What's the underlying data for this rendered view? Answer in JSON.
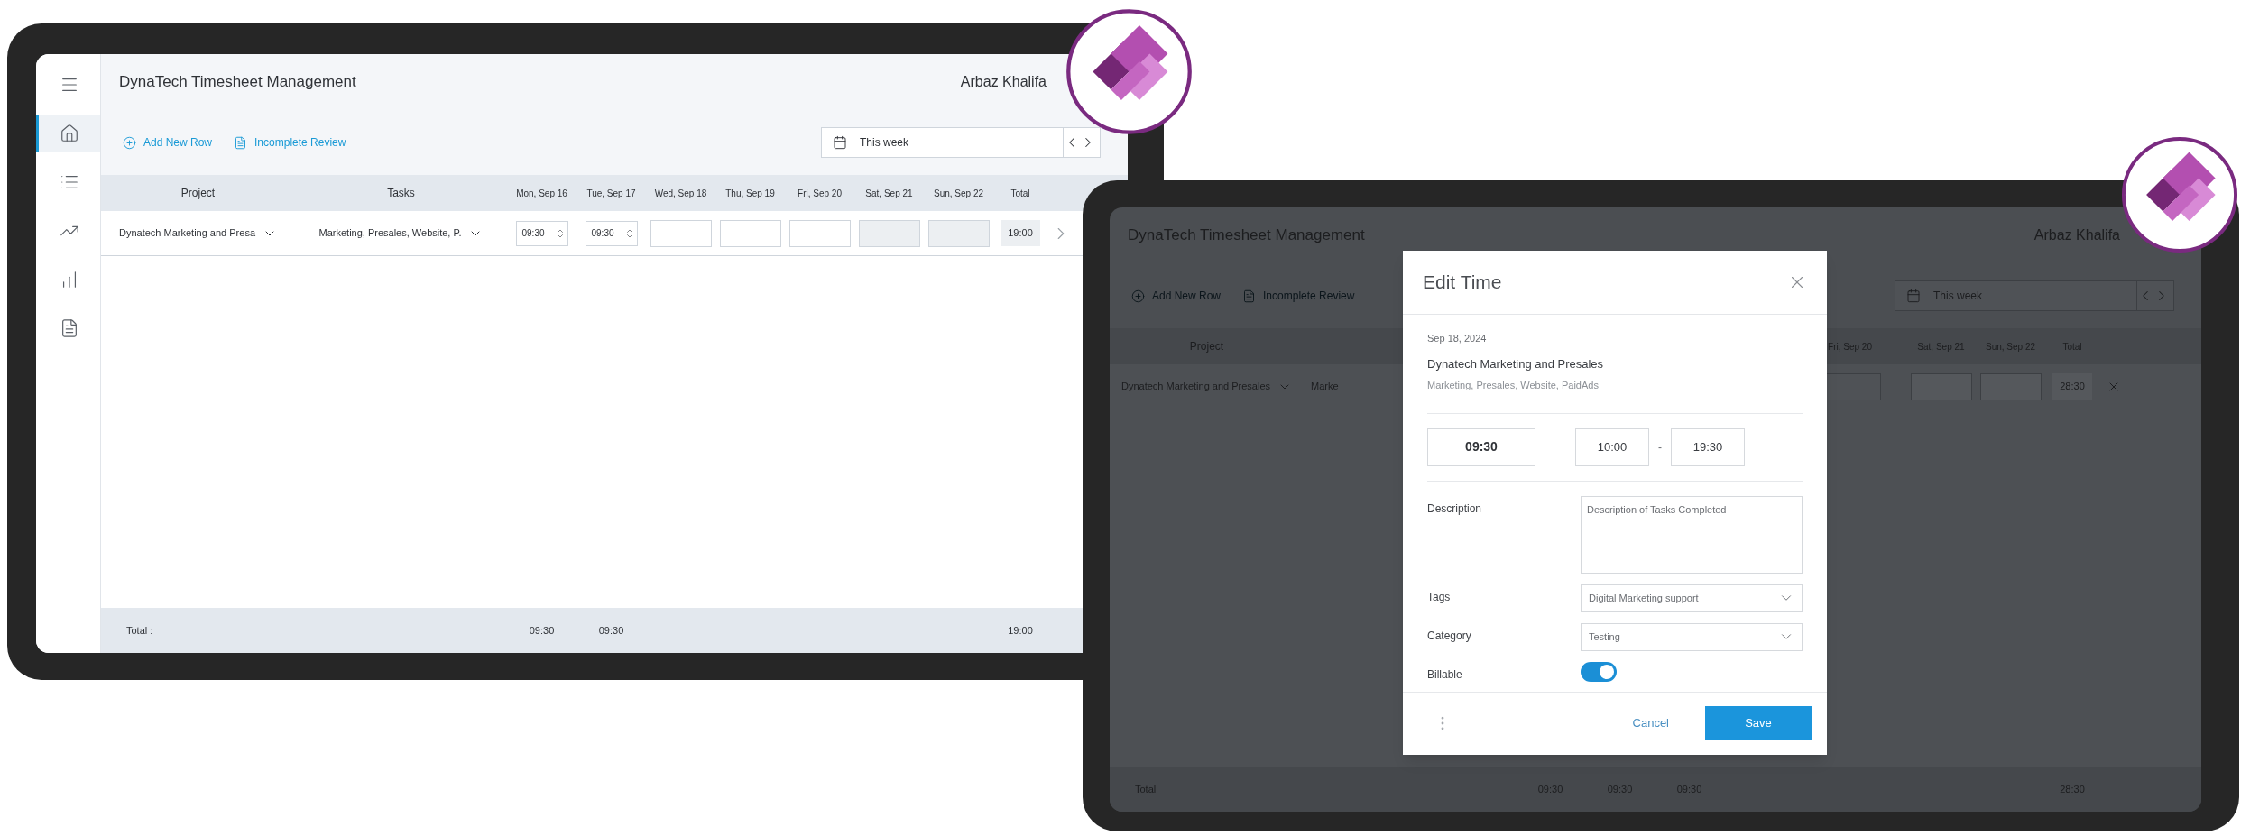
{
  "screens": [
    {
      "dimmed": false,
      "sidebar": [
        {
          "kind": "menu",
          "selected": false
        },
        {
          "kind": "home",
          "selected": true
        },
        {
          "kind": "list",
          "selected": false
        },
        {
          "kind": "trend",
          "selected": false
        },
        {
          "kind": "bars",
          "selected": false
        },
        {
          "kind": "pdf",
          "selected": false
        }
      ],
      "title": "DynaTech Timesheet Management",
      "user": "Arbaz Khalifa",
      "actions": [
        {
          "kind": "add",
          "label": "Add New Row"
        },
        {
          "kind": "review",
          "label": "Incomplete Review"
        }
      ],
      "week": "This week",
      "columns": [
        {
          "kind": "shown",
          "label": "Project"
        },
        {
          "kind": "shown",
          "label": "Tasks"
        },
        {
          "kind": "shown",
          "label": "Mon, Sep 16"
        },
        {
          "kind": "shown",
          "label": "Tue, Sep 17"
        },
        {
          "kind": "shown",
          "label": "Wed, Sep 18"
        },
        {
          "kind": "shown",
          "label": "Thu, Sep 19"
        },
        {
          "kind": "shown",
          "label": "Fri, Sep 20"
        },
        {
          "kind": "shown",
          "label": "Sat, Sep 21"
        },
        {
          "kind": "shown",
          "label": "Sun, Sep 22"
        },
        {
          "kind": "shown",
          "label": "Total"
        }
      ],
      "row": [
        {
          "kind": "select",
          "text": "Dynatech Marketing and Presa"
        },
        {
          "kind": "select",
          "text": "Marketing, Presales, Website, P."
        },
        {
          "kind": "time",
          "text": "09:30"
        },
        {
          "kind": "time",
          "text": "09:30"
        },
        {
          "kind": "empty"
        },
        {
          "kind": "empty"
        },
        {
          "kind": "empty"
        },
        {
          "kind": "disabled"
        },
        {
          "kind": "disabled"
        },
        {
          "kind": "total",
          "text": "19:00"
        },
        {
          "kind": "next"
        }
      ],
      "footer": [
        {
          "kind": "label",
          "text": "Total :"
        },
        {
          "kind": "blank"
        },
        {
          "kind": "value",
          "text": "09:30"
        },
        {
          "kind": "value",
          "text": "09:30"
        },
        {
          "kind": "blank"
        },
        {
          "kind": "blank"
        },
        {
          "kind": "blank"
        },
        {
          "kind": "blank"
        },
        {
          "kind": "blank"
        },
        {
          "kind": "value",
          "text": "19:00"
        }
      ]
    },
    {
      "dimmed": true,
      "title": "DynaTech Timesheet Management",
      "user": "Arbaz Khalifa",
      "actions": [
        {
          "kind": "add",
          "label": "Add New Row"
        },
        {
          "kind": "review",
          "label": "Incomplete Review"
        }
      ],
      "week": "This week",
      "columns": [
        {
          "kind": "shown",
          "label": "Project"
        },
        {
          "kind": "covered"
        },
        {
          "kind": "covered"
        },
        {
          "kind": "covered"
        },
        {
          "kind": "covered"
        },
        {
          "kind": "covered"
        },
        {
          "kind": "shown",
          "label": "Fri, Sep 20"
        },
        {
          "kind": "shown",
          "label": "Sat, Sep 21"
        },
        {
          "kind": "shown",
          "label": "Sun, Sep 22"
        },
        {
          "kind": "shown",
          "label": "Total"
        }
      ],
      "row": [
        {
          "kind": "select",
          "text": "Dynatech Marketing and Presales"
        },
        {
          "kind": "text",
          "text": "Marke"
        },
        {
          "kind": "covered"
        },
        {
          "kind": "covered"
        },
        {
          "kind": "covered"
        },
        {
          "kind": "covered"
        },
        {
          "kind": "empty"
        },
        {
          "kind": "disabled"
        },
        {
          "kind": "disabled"
        },
        {
          "kind": "total",
          "text": "28:30"
        },
        {
          "kind": "remove"
        }
      ],
      "footer": [
        {
          "kind": "label",
          "text": "Total"
        },
        {
          "kind": "blank"
        },
        {
          "kind": "value",
          "text": "09:30"
        },
        {
          "kind": "value",
          "text": "09:30"
        },
        {
          "kind": "value",
          "text": "09:30"
        },
        {
          "kind": "blank"
        },
        {
          "kind": "blank"
        },
        {
          "kind": "blank"
        },
        {
          "kind": "blank"
        },
        {
          "kind": "value",
          "text": "28:30"
        }
      ]
    }
  ],
  "dialog": {
    "title": "Edit Time",
    "date": "Sep 18, 2024",
    "project": "Dynatech Marketing and Presales",
    "tasks": "Marketing, Presales, Website, PaidAds",
    "duration": "09:30",
    "start": "10:00",
    "separator": "-",
    "end": "19:30",
    "fields": [
      {
        "kind": "textarea",
        "label": "Description",
        "placeholder": "Description of Tasks Completed"
      },
      {
        "kind": "select",
        "label": "Tags",
        "value": "Digital Marketing support"
      },
      {
        "kind": "select",
        "label": "Category",
        "value": "Testing"
      },
      {
        "kind": "toggle",
        "label": "Billable",
        "on": true
      }
    ],
    "buttons": [
      {
        "kind": "secondary",
        "label": "Cancel"
      },
      {
        "kind": "primary",
        "label": "Save"
      }
    ]
  }
}
